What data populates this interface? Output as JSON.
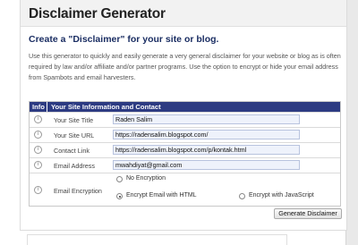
{
  "header": {
    "title": "Disclaimer Generator"
  },
  "subtitle": "Create a \"Disclaimer\" for your site or blog.",
  "description": "Use this generator to quickly and easily generate a very general disclaimer for your website or blog as is often required by law and/or affiliate and/or partner programs. Use the option to encrypt or hide your email address from Spambots and email harvesters.",
  "table": {
    "col_info": "Info",
    "col_main": "Your Site Information and Contact",
    "fields": [
      {
        "label": "Your Site Title",
        "value": "Raden Salim"
      },
      {
        "label": "Your Site URL",
        "value": "https://radensalim.blogspot.com/"
      },
      {
        "label": "Contact Link",
        "value": "https://radensalim.blogspot.com/p/kontak.html"
      },
      {
        "label": "Email Address",
        "value": "mwahdiyat@gmail.com"
      }
    ],
    "encryption": {
      "label": "Email Encryption",
      "options": [
        "No Encryption",
        "Encrypt Email with HTML",
        "Encrypt with JavaScript"
      ],
      "selected": "Encrypt Email with HTML"
    },
    "info_glyph": "i"
  },
  "button": {
    "label": "Generate Disclaimer"
  }
}
